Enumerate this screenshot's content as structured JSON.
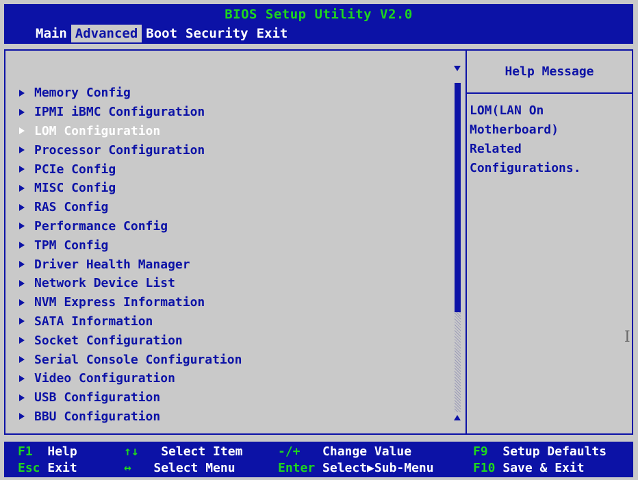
{
  "header": {
    "title": "BIOS Setup Utility V2.0",
    "tabs": [
      "Main",
      "Advanced",
      "Boot",
      "Security",
      "Exit"
    ],
    "active_tab": "Advanced"
  },
  "menu": {
    "items": [
      "Memory Config",
      "IPMI iBMC Configuration",
      "LOM Configuration",
      "Processor Configuration",
      "PCIe Config",
      "MISC Config",
      "RAS Config",
      "Performance Config",
      "TPM Config",
      "Driver Health Manager",
      "Network Device List",
      "NVM Express Information",
      "SATA Information",
      "Socket Configuration",
      "Serial Console Configuration",
      "Video Configuration",
      "USB Configuration",
      "BBU Configuration"
    ],
    "selected": "LOM Configuration"
  },
  "help": {
    "title": "Help Message",
    "lines": [
      "LOM(LAN On",
      "Motherboard)",
      "Related",
      "Configurations."
    ]
  },
  "footer": {
    "keys": [
      {
        "key": "F1",
        "desc": "Help"
      },
      {
        "key": "Esc",
        "desc": "Exit"
      },
      {
        "key": "↑↓",
        "desc": "Select Item"
      },
      {
        "key": "↔",
        "desc": "Select Menu"
      },
      {
        "key": "-/+",
        "desc": "Change Value"
      },
      {
        "key": "Enter",
        "desc": "Select▶Sub-Menu"
      },
      {
        "key": "F9",
        "desc": "Setup Defaults"
      },
      {
        "key": "F10",
        "desc": "Save & Exit"
      }
    ]
  },
  "colors": {
    "blue": "#0c12a6",
    "green": "#1ed61e",
    "gray": "#c9c9c9",
    "white": "#ffffff"
  }
}
